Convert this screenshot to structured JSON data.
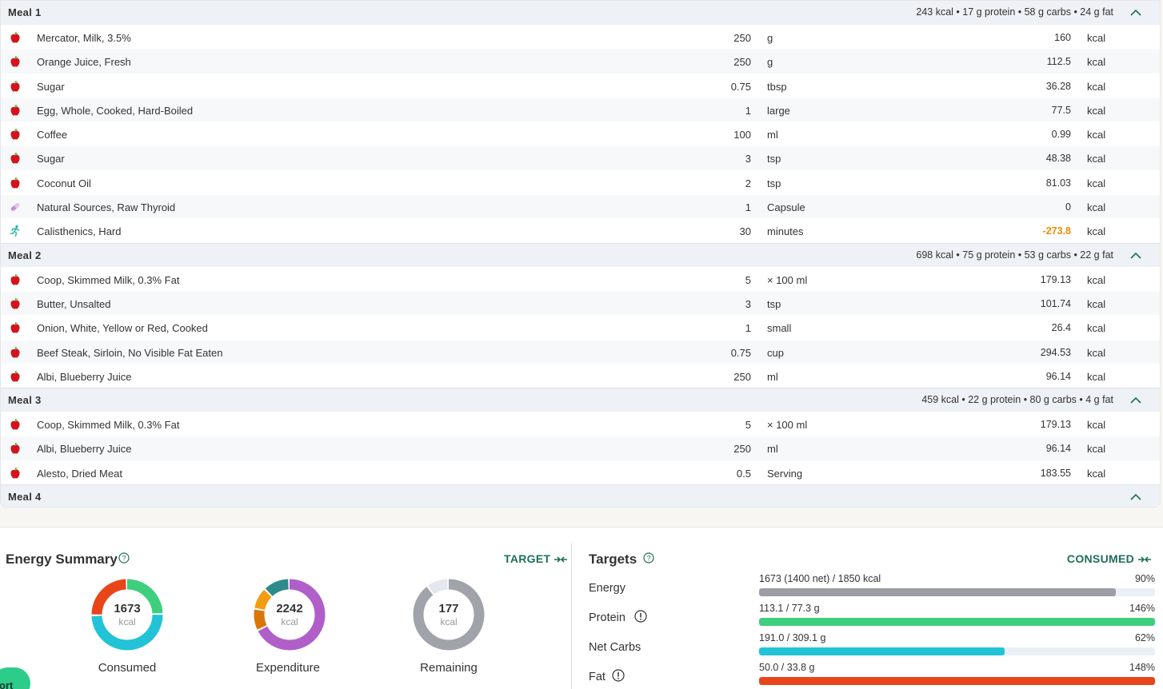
{
  "meals": [
    {
      "name": "Meal 1",
      "summary": "243 kcal • 17 g protein • 58 g carbs • 24 g fat",
      "items": [
        {
          "icon": "apple-icon",
          "name": "Mercator, Milk, 3.5%",
          "amount": "250",
          "unit": "g",
          "kcal": "160",
          "kcal_unit": "kcal"
        },
        {
          "icon": "apple-icon",
          "name": "Orange Juice, Fresh",
          "amount": "250",
          "unit": "g",
          "kcal": "112.5",
          "kcal_unit": "kcal"
        },
        {
          "icon": "apple-icon",
          "name": "Sugar",
          "amount": "0.75",
          "unit": "tbsp",
          "kcal": "36.28",
          "kcal_unit": "kcal"
        },
        {
          "icon": "apple-icon",
          "name": "Egg, Whole, Cooked, Hard-Boiled",
          "amount": "1",
          "unit": "large",
          "kcal": "77.5",
          "kcal_unit": "kcal"
        },
        {
          "icon": "apple-icon",
          "name": "Coffee",
          "amount": "100",
          "unit": "ml",
          "kcal": "0.99",
          "kcal_unit": "kcal"
        },
        {
          "icon": "apple-icon",
          "name": "Sugar",
          "amount": "3",
          "unit": "tsp",
          "kcal": "48.38",
          "kcal_unit": "kcal"
        },
        {
          "icon": "apple-icon",
          "name": "Coconut Oil",
          "amount": "2",
          "unit": "tsp",
          "kcal": "81.03",
          "kcal_unit": "kcal"
        },
        {
          "icon": "pill-icon",
          "name": "Natural Sources, Raw Thyroid",
          "amount": "1",
          "unit": "Capsule",
          "kcal": "0",
          "kcal_unit": "kcal"
        },
        {
          "icon": "running-icon",
          "name": "Calisthenics, Hard",
          "amount": "30",
          "unit": "minutes",
          "kcal": "-273.8",
          "kcal_unit": "kcal",
          "negative": true
        }
      ]
    },
    {
      "name": "Meal 2",
      "summary": "698 kcal • 75 g protein • 53 g carbs • 22 g fat",
      "items": [
        {
          "icon": "apple-icon",
          "name": "Coop, Skimmed Milk, 0.3% Fat",
          "amount": "5",
          "unit": "× 100 ml",
          "kcal": "179.13",
          "kcal_unit": "kcal"
        },
        {
          "icon": "apple-icon",
          "name": "Butter, Unsalted",
          "amount": "3",
          "unit": "tsp",
          "kcal": "101.74",
          "kcal_unit": "kcal"
        },
        {
          "icon": "apple-icon",
          "name": "Onion, White, Yellow or Red, Cooked",
          "amount": "1",
          "unit": "small",
          "kcal": "26.4",
          "kcal_unit": "kcal"
        },
        {
          "icon": "apple-icon",
          "name": "Beef Steak, Sirloin, No Visible Fat Eaten",
          "amount": "0.75",
          "unit": "cup",
          "kcal": "294.53",
          "kcal_unit": "kcal"
        },
        {
          "icon": "apple-icon",
          "name": "Albi, Blueberry Juice",
          "amount": "250",
          "unit": "ml",
          "kcal": "96.14",
          "kcal_unit": "kcal"
        }
      ]
    },
    {
      "name": "Meal 3",
      "summary": "459 kcal • 22 g protein • 80 g carbs • 4 g fat",
      "items": [
        {
          "icon": "apple-icon",
          "name": "Coop, Skimmed Milk, 0.3% Fat",
          "amount": "5",
          "unit": "× 100 ml",
          "kcal": "179.13",
          "kcal_unit": "kcal"
        },
        {
          "icon": "apple-icon",
          "name": "Albi, Blueberry Juice",
          "amount": "250",
          "unit": "ml",
          "kcal": "96.14",
          "kcal_unit": "kcal"
        },
        {
          "icon": "apple-icon",
          "name": "Alesto, Dried Meat",
          "amount": "0.5",
          "unit": "Serving",
          "kcal": "183.55",
          "kcal_unit": "kcal"
        }
      ]
    },
    {
      "name": "Meal 4",
      "summary": "",
      "items": []
    }
  ],
  "energy_summary": {
    "title": "Energy Summary",
    "toggle_label": "TARGET",
    "donuts": [
      {
        "value": "1673",
        "unit": "kcal",
        "label": "Consumed",
        "segments": [
          {
            "color": "#3ecf7e",
            "frac": 0.25
          },
          {
            "color": "#22c3d6",
            "frac": 0.5
          },
          {
            "color": "#e8451b",
            "frac": 0.25
          }
        ]
      },
      {
        "value": "2242",
        "unit": "kcal",
        "label": "Expenditure",
        "segments": [
          {
            "color": "#b05fc9",
            "frac": 0.68
          },
          {
            "color": "#d97706",
            "frac": 0.1
          },
          {
            "color": "#f39c12",
            "frac": 0.1
          },
          {
            "color": "#2e8b8b",
            "frac": 0.12
          }
        ]
      },
      {
        "value": "177",
        "unit": "kcal",
        "label": "Remaining",
        "segments": [
          {
            "color": "#a0a4aa",
            "frac": 0.9
          },
          {
            "color": "#e4e7ec",
            "frac": 0.1
          }
        ]
      }
    ]
  },
  "targets": {
    "title": "Targets",
    "toggle_label": "CONSUMED",
    "rows": [
      {
        "label": "Energy",
        "info": false,
        "text": "1673 (1400 net) / 1850 kcal",
        "pct": "90%",
        "fill": 0.9,
        "color": "#9b9ea5"
      },
      {
        "label": "Protein",
        "info": true,
        "text": "113.1 / 77.3 g",
        "pct": "146%",
        "fill": 1.0,
        "color": "#3ecf7e"
      },
      {
        "label": "Net Carbs",
        "info": false,
        "text": "191.0 / 309.1 g",
        "pct": "62%",
        "fill": 0.62,
        "color": "#22c3d6"
      },
      {
        "label": "Fat",
        "info": true,
        "text": "50.0 / 33.8 g",
        "pct": "148%",
        "fill": 1.0,
        "color": "#e8451b"
      }
    ]
  },
  "support_button": {
    "label": "ort"
  }
}
